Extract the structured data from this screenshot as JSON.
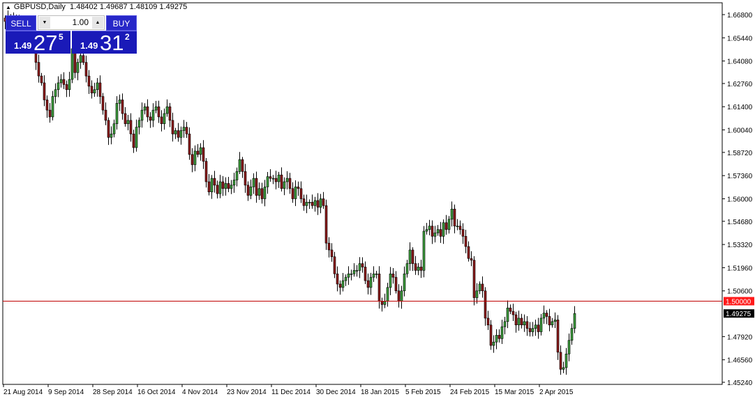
{
  "header": {
    "symbol": "GBPUSD,Daily",
    "ohlc": "1.48402 1.49687 1.48109 1.49275",
    "icon": "triangle-up-icon"
  },
  "trade_panel": {
    "sell_label": "SELL",
    "buy_label": "BUY",
    "lot_size": "1.00",
    "sell_price": {
      "prefix": "1.49",
      "big": "27",
      "sup": "5"
    },
    "buy_price": {
      "prefix": "1.49",
      "big": "31",
      "sup": "2"
    }
  },
  "colors": {
    "bull": "#3c9c3c",
    "bear": "#8b1a1a",
    "level_line": "#c00000",
    "level_label_bg": "#ff1a1a",
    "bid_label_bg": "#000000",
    "panel": "#1a1ab8"
  },
  "chart_data": {
    "type": "candlestick",
    "title": "GBPUSD,Daily",
    "price_ticks": [
      "1.66800",
      "1.65440",
      "1.64080",
      "1.62760",
      "1.61400",
      "1.60040",
      "1.58720",
      "1.57360",
      "1.56000",
      "1.54680",
      "1.53320",
      "1.51960",
      "1.50600",
      "1.47920",
      "1.46560",
      "1.45240"
    ],
    "date_ticks": [
      "21 Aug 2014",
      "9 Sep 2014",
      "28 Sep 2014",
      "16 Oct 2014",
      "4 Nov 2014",
      "23 Nov 2014",
      "11 Dec 2014",
      "30 Dec 2014",
      "18 Jan 2015",
      "5 Feb 2015",
      "24 Feb 2015",
      "15 Mar 2015",
      "2 Apr 2015"
    ],
    "date_tick_every_bars": 16,
    "level_line": {
      "price": 1.5,
      "label": "1.50000"
    },
    "bid_label": "1.49275",
    "ylim": [
      1.4492,
      1.6743
    ],
    "closes": [
      1.664,
      1.666,
      1.663,
      1.665,
      1.662,
      1.664,
      1.661,
      1.663,
      1.66,
      1.662,
      1.658,
      1.64,
      1.632,
      1.628,
      1.618,
      1.612,
      1.608,
      1.62,
      1.624,
      1.628,
      1.63,
      1.627,
      1.624,
      1.63,
      1.648,
      1.634,
      1.64,
      1.644,
      1.64,
      1.632,
      1.626,
      1.622,
      1.624,
      1.628,
      1.62,
      1.612,
      1.606,
      1.596,
      1.598,
      1.604,
      1.616,
      1.618,
      1.61,
      1.604,
      1.606,
      1.598,
      1.59,
      1.602,
      1.606,
      1.612,
      1.614,
      1.608,
      1.606,
      1.612,
      1.614,
      1.608,
      1.604,
      1.61,
      1.614,
      1.606,
      1.598,
      1.6,
      1.596,
      1.6,
      1.602,
      1.598,
      1.586,
      1.58,
      1.588,
      1.586,
      1.59,
      1.582,
      1.57,
      1.564,
      1.572,
      1.568,
      1.563,
      1.57,
      1.566,
      1.569,
      1.566,
      1.568,
      1.571,
      1.576,
      1.583,
      1.576,
      1.568,
      1.562,
      1.567,
      1.572,
      1.562,
      1.566,
      1.56,
      1.567,
      1.573,
      1.572,
      1.572,
      1.57,
      1.574,
      1.566,
      1.57,
      1.572,
      1.566,
      1.56,
      1.567,
      1.566,
      1.56,
      1.556,
      1.558,
      1.558,
      1.556,
      1.559,
      1.555,
      1.56,
      1.556,
      1.534,
      1.53,
      1.526,
      1.516,
      1.51,
      1.508,
      1.512,
      1.514,
      1.516,
      1.516,
      1.518,
      1.518,
      1.522,
      1.52,
      1.512,
      1.508,
      1.514,
      1.516,
      1.516,
      1.5,
      1.498,
      1.5,
      1.508,
      1.516,
      1.514,
      1.506,
      1.5,
      1.506,
      1.516,
      1.522,
      1.53,
      1.522,
      1.518,
      1.52,
      1.518,
      1.541,
      1.542,
      1.544,
      1.538,
      1.54,
      1.542,
      1.538,
      1.546,
      1.542,
      1.548,
      1.554,
      1.544,
      1.544,
      1.542,
      1.538,
      1.532,
      1.525,
      1.524,
      1.502,
      1.506,
      1.51,
      1.506,
      1.49,
      1.486,
      1.474,
      1.476,
      1.48,
      1.478,
      1.485,
      1.488,
      1.496,
      1.494,
      1.492,
      1.486,
      1.49,
      1.486,
      1.488,
      1.484,
      1.482,
      1.484,
      1.486,
      1.482,
      1.49,
      1.493,
      1.491,
      1.486,
      1.488,
      1.489,
      1.47,
      1.46,
      1.461,
      1.469,
      1.477,
      1.484,
      1.49275
    ]
  }
}
